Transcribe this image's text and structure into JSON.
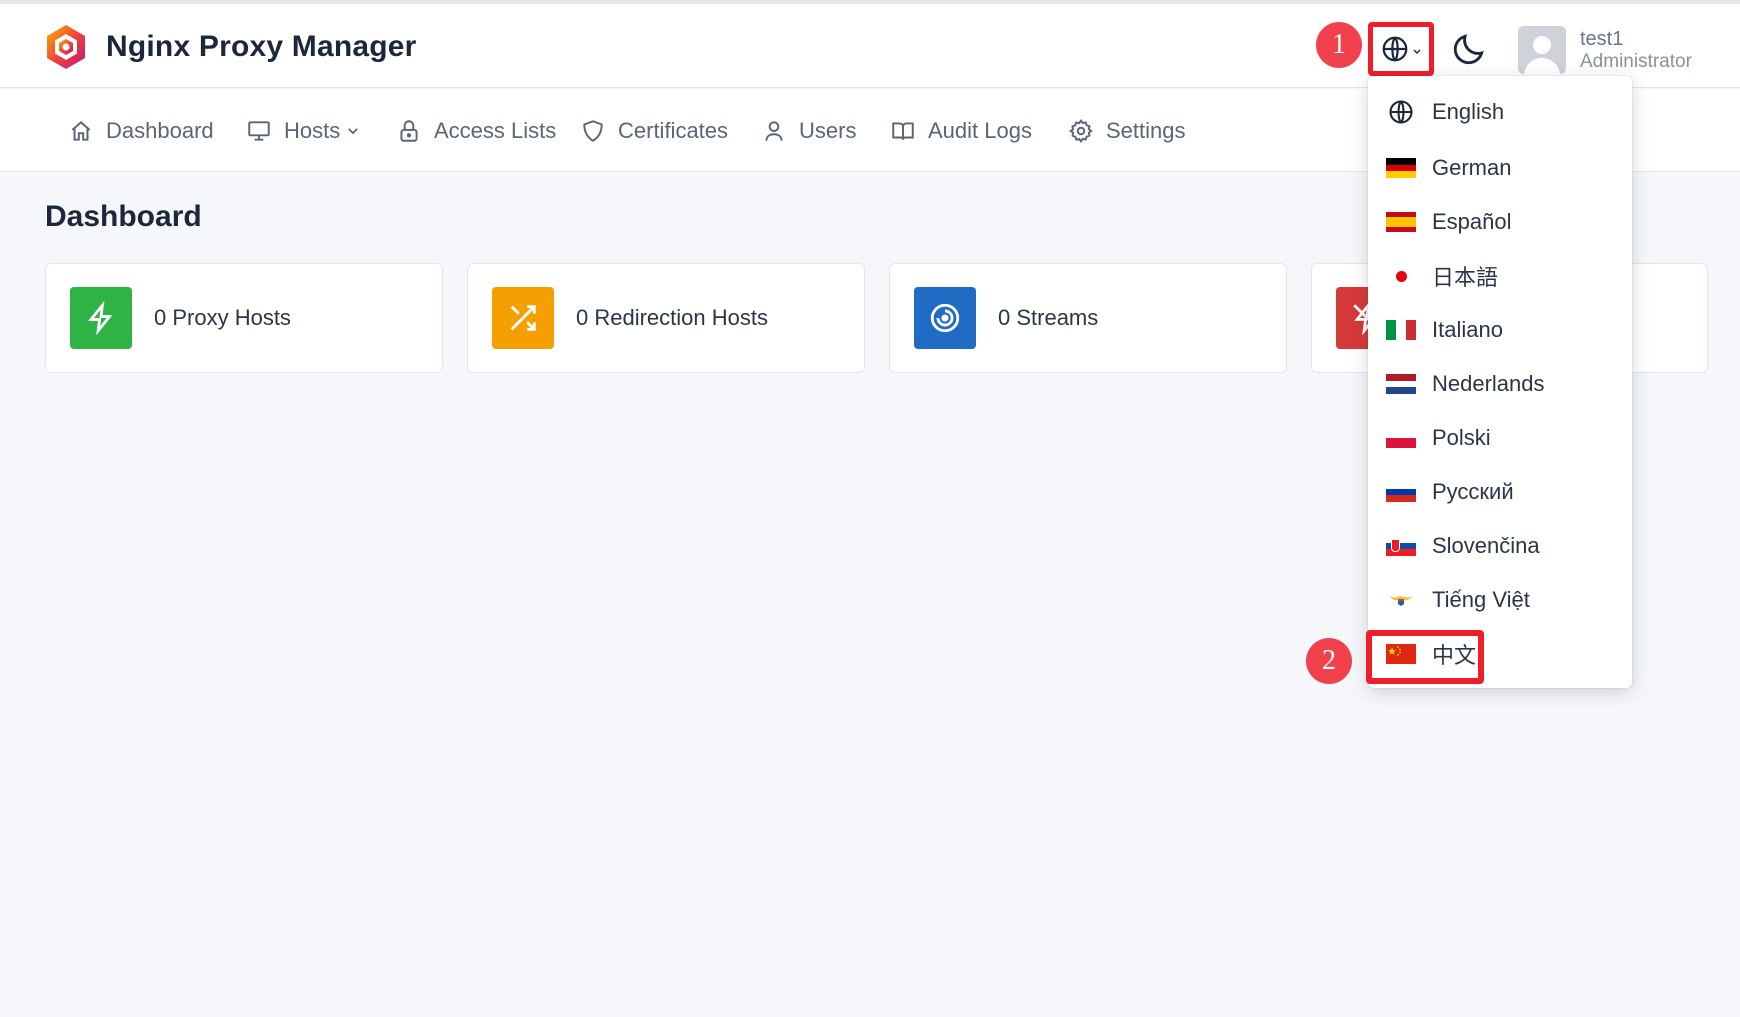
{
  "colors": {
    "accent_red": "#ef1f29",
    "badge_red": "#f1414d",
    "proxy_green": "#2fb344",
    "redirection_orange": "#f59f00",
    "streams_blue": "#206bc4",
    "dead_red": "#d63939"
  },
  "header": {
    "brand_title": "Nginx Proxy Manager",
    "brand_icon": "hexagon-logo-icon",
    "language_icon": "globe-icon",
    "theme_icon": "moon-icon",
    "step1": "1",
    "user": {
      "name": "test1",
      "role": "Administrator"
    }
  },
  "nav": {
    "items": [
      {
        "label": "Dashboard",
        "icon": "home-icon"
      },
      {
        "label": "Hosts",
        "icon": "monitor-icon"
      },
      {
        "label": "Access Lists",
        "icon": "lock-icon"
      },
      {
        "label": "Certificates",
        "icon": "shield-icon"
      },
      {
        "label": "Users",
        "icon": "user-icon"
      },
      {
        "label": "Audit Logs",
        "icon": "book-icon"
      },
      {
        "label": "Settings",
        "icon": "gear-icon"
      }
    ]
  },
  "main": {
    "title": "Dashboard",
    "cards": [
      {
        "label": "0 Proxy Hosts",
        "icon": "bolt-icon"
      },
      {
        "label": "0 Redirection Hosts",
        "icon": "shuffle-icon"
      },
      {
        "label": "0 Streams",
        "icon": "target-icon"
      },
      {
        "label": "",
        "icon": "bolt-off-icon"
      }
    ]
  },
  "language_menu": {
    "step2": "2",
    "items": [
      {
        "label": "English",
        "icon": "globe-icon"
      },
      {
        "label": "German",
        "icon": "flag-de-icon"
      },
      {
        "label": "Español",
        "icon": "flag-es-icon"
      },
      {
        "label": "日本語",
        "icon": "flag-jp-icon"
      },
      {
        "label": "Italiano",
        "icon": "flag-it-icon"
      },
      {
        "label": "Nederlands",
        "icon": "flag-nl-icon"
      },
      {
        "label": "Polski",
        "icon": "flag-pl-icon"
      },
      {
        "label": "Русский",
        "icon": "flag-ru-icon"
      },
      {
        "label": "Slovenčina",
        "icon": "flag-sk-icon"
      },
      {
        "label": "Tiếng Việt",
        "icon": "flag-vi-icon"
      },
      {
        "label": "中文",
        "icon": "flag-cn-icon"
      }
    ]
  }
}
